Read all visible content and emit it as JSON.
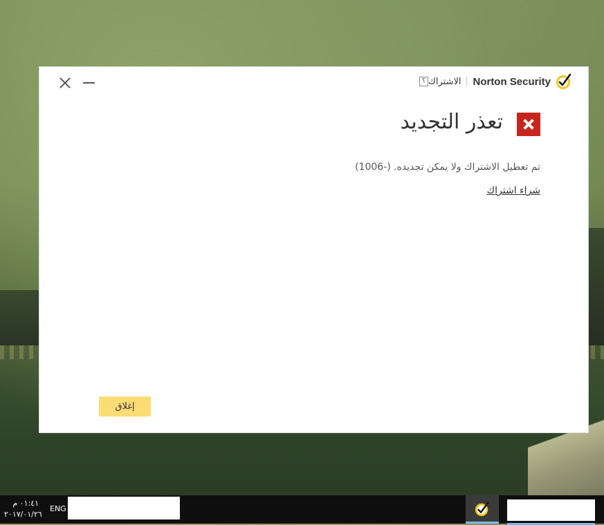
{
  "window": {
    "brand_name": "Norton Security",
    "subscription_link": "الاشتراك",
    "help_mark": "؟",
    "title": "تعذر التجديد",
    "message": "تم تعطيل الاشتراك ولا يمكن تجديده. (-1006)",
    "buy_link": "شراء اشتراك",
    "close_button": "إغلاق"
  },
  "taskbar": {
    "time": "٠١:٤١ م",
    "date": "٢٠١٧/٠١/٢٦",
    "language": "ENG"
  },
  "colors": {
    "error_red": "#c8261c",
    "button_yellow": "#fcdc74",
    "norton_yellow": "#f6c61a"
  }
}
